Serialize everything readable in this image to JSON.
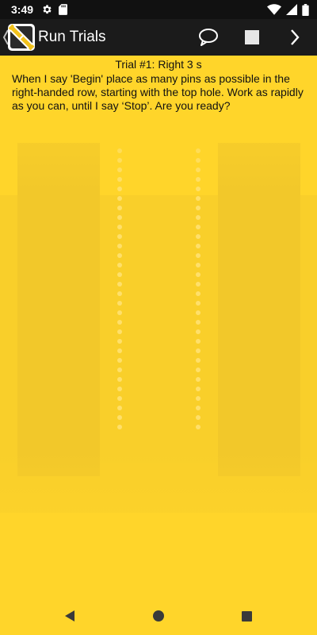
{
  "status_bar": {
    "time": "3:49",
    "icons": [
      "gear-icon",
      "sd-card-icon",
      "wifi-icon",
      "signal-icon",
      "battery-icon"
    ]
  },
  "app_bar": {
    "title": "Run Trials",
    "actions": [
      "speech-bubble-icon",
      "stop-square-icon",
      "chevron-right-icon"
    ]
  },
  "content": {
    "trial_title": "Trial #1: Right 3 s",
    "instructions": "When I say 'Begin' place as many pins as possible in the right-handed row, starting with the top hole.  Work as rapidly as you can, until I say ‘Stop’. Are you ready?"
  },
  "nav_bar": {
    "buttons": [
      "back-triangle-icon",
      "home-circle-icon",
      "recents-square-icon"
    ]
  },
  "colors": {
    "background": "#ffd52a",
    "app_bar": "#1b1b1b",
    "status_bar": "#111111",
    "text": "#111111"
  }
}
